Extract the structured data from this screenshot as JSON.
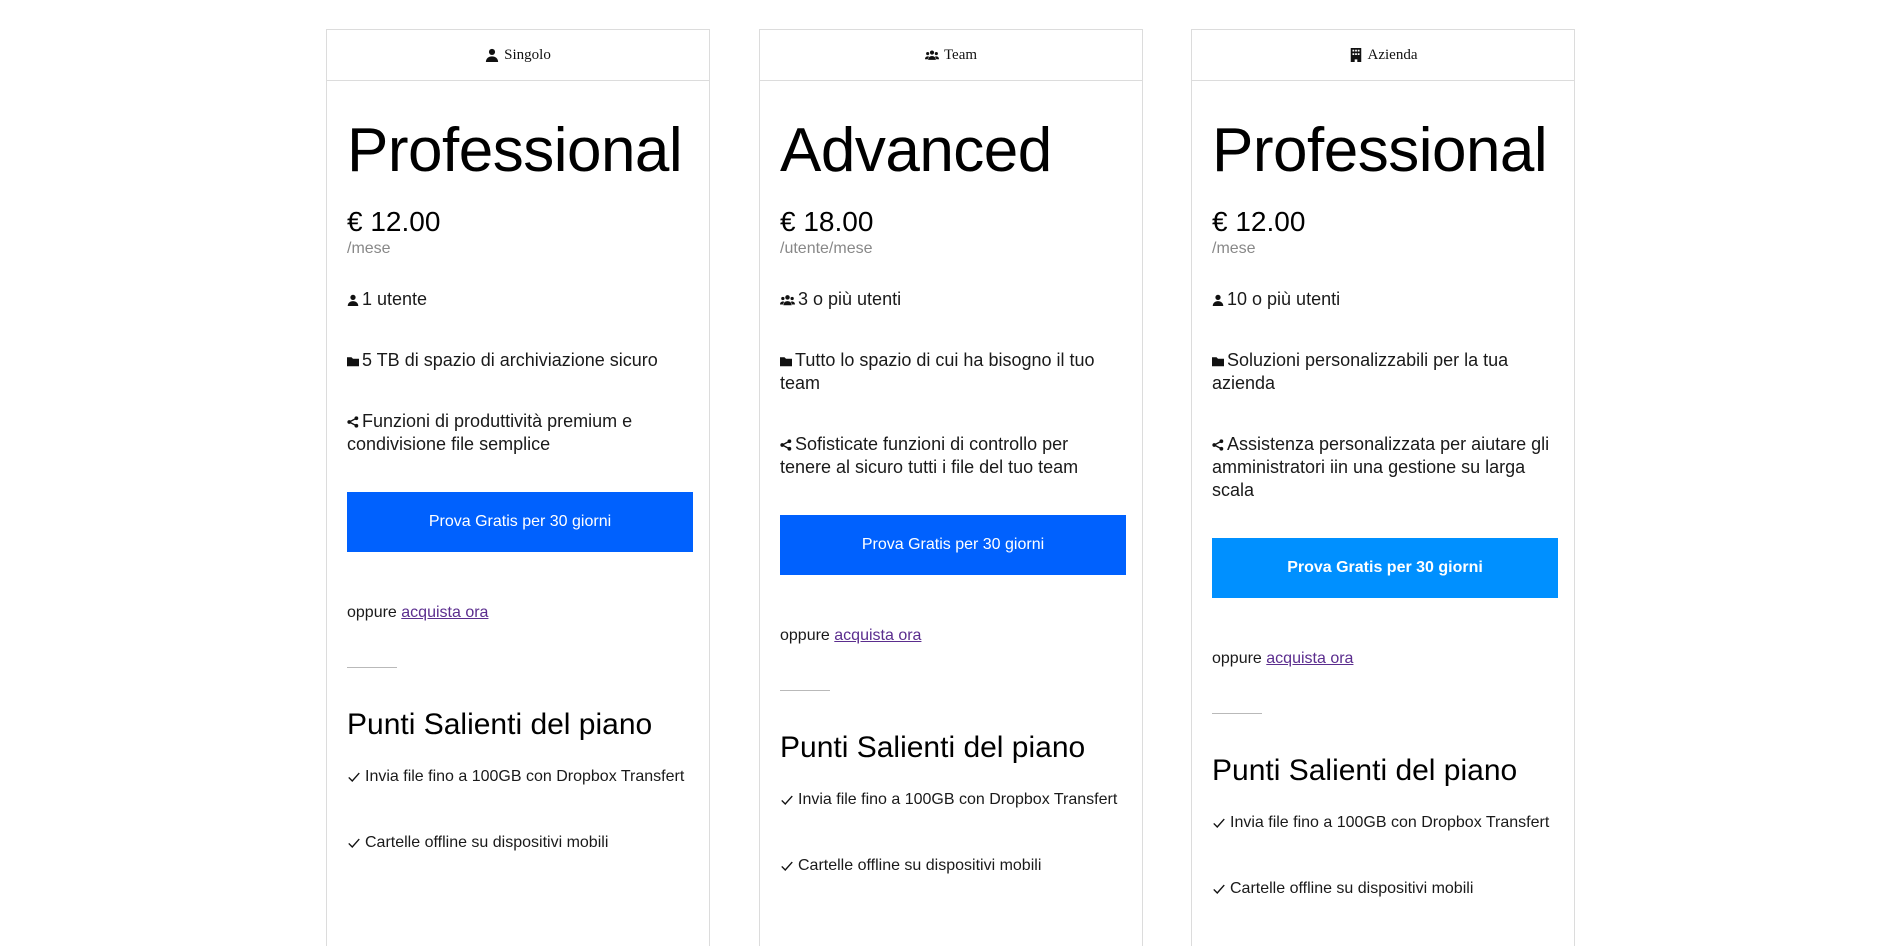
{
  "plans": [
    {
      "tab_label": "Singolo",
      "tab_icon": "user-icon",
      "name": "Professional",
      "price": "€ 12.00",
      "period": "/mese",
      "features": [
        {
          "icon": "user-icon",
          "text": "1 utente"
        },
        {
          "icon": "folder-icon",
          "text": "5 TB di spazio di archiviazione sicuro"
        },
        {
          "icon": "share-icon",
          "text": "Funzioni di produttività premium e condivisione file semplice"
        }
      ],
      "cta_label": "Prova Gratis per 30 giorni",
      "cta_color": "#0061fe",
      "or_text": "oppure",
      "buy_link": "acquista ora",
      "highlights_title": "Punti Salienti del piano",
      "highlights": [
        "Invia file fino a 100GB con Dropbox Transfert",
        "Cartelle offline su dispositivi mobili"
      ]
    },
    {
      "tab_label": "Team",
      "tab_icon": "users-icon",
      "name": "Advanced",
      "price": "€ 18.00",
      "period": "/utente/mese",
      "features": [
        {
          "icon": "users-icon",
          "text": "3 o più utenti"
        },
        {
          "icon": "folder-icon",
          "text": "Tutto lo spazio di cui ha bisogno il tuo team"
        },
        {
          "icon": "share-icon",
          "text": "Sofisticate funzioni di controllo per tenere al sicuro tutti i file del tuo team"
        }
      ],
      "cta_label": "Prova Gratis per 30 giorni",
      "cta_color": "#0061fe",
      "or_text": "oppure",
      "buy_link": "acquista ora",
      "highlights_title": "Punti Salienti del piano",
      "highlights": [
        "Invia file fino a 100GB con Dropbox Transfert",
        "Cartelle offline su dispositivi mobili"
      ]
    },
    {
      "tab_label": "Azienda",
      "tab_icon": "building-icon",
      "name": "Professional",
      "price": "€ 12.00",
      "period": "/mese",
      "features": [
        {
          "icon": "user-icon",
          "text": "10 o più utenti"
        },
        {
          "icon": "folder-icon",
          "text": "Soluzioni personalizzabili per la tua azienda"
        },
        {
          "icon": "share-icon",
          "text": "Assistenza personalizzata per aiutare gli amministratori iin una gestione su larga scala"
        }
      ],
      "cta_label": "Prova Gratis per 30 giorni",
      "cta_color": "#0090ff",
      "or_text": "oppure",
      "buy_link": "acquista ora",
      "highlights_title": "Punti Salienti del piano",
      "highlights": [
        "Invia file fino a 100GB con Dropbox Transfert",
        "Cartelle offline su dispositivi mobili"
      ]
    }
  ]
}
